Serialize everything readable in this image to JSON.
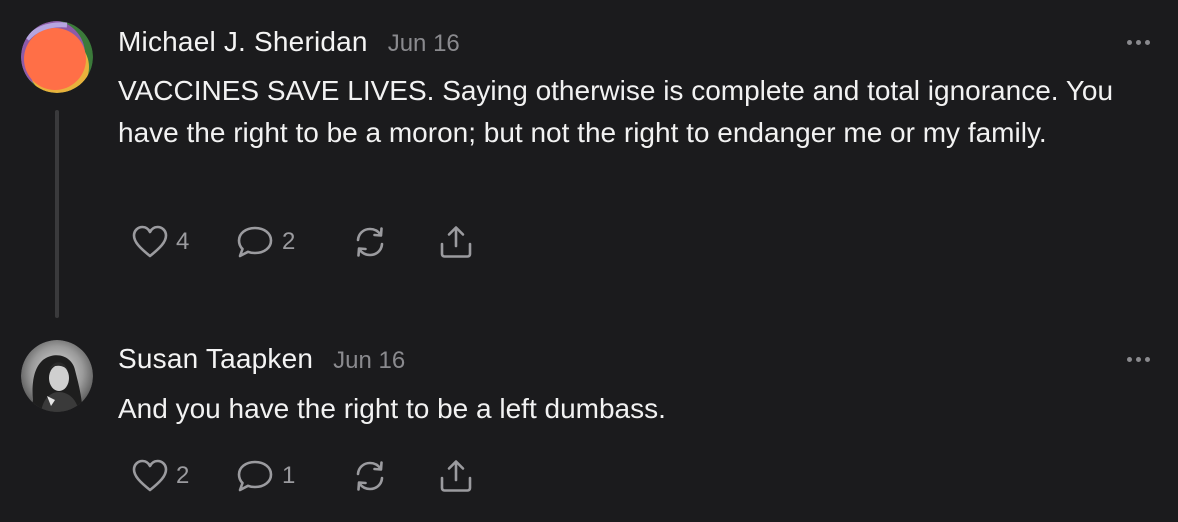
{
  "comments": [
    {
      "author": "Michael J. Sheridan",
      "date": "Jun 16",
      "body": "VACCINES SAVE LIVES. Saying otherwise is complete and total ignorance. You have the right to be a moron; but not the right to endanger me or my family.",
      "likes": "4",
      "replies": "2"
    },
    {
      "author": "Susan Taapken",
      "date": "Jun 16",
      "body": "And you have the right to be a left dumbass.",
      "likes": "2",
      "replies": "1"
    }
  ],
  "icons": {
    "like": "heart-icon",
    "reply": "speech-bubble-icon",
    "restack": "restack-icon",
    "share": "share-icon",
    "more": "more-horizontal-icon"
  },
  "colors": {
    "background": "#1b1b1d",
    "text": "#f2f2f2",
    "muted": "#8a8a8e",
    "thread_line": "#3a3a3c"
  }
}
